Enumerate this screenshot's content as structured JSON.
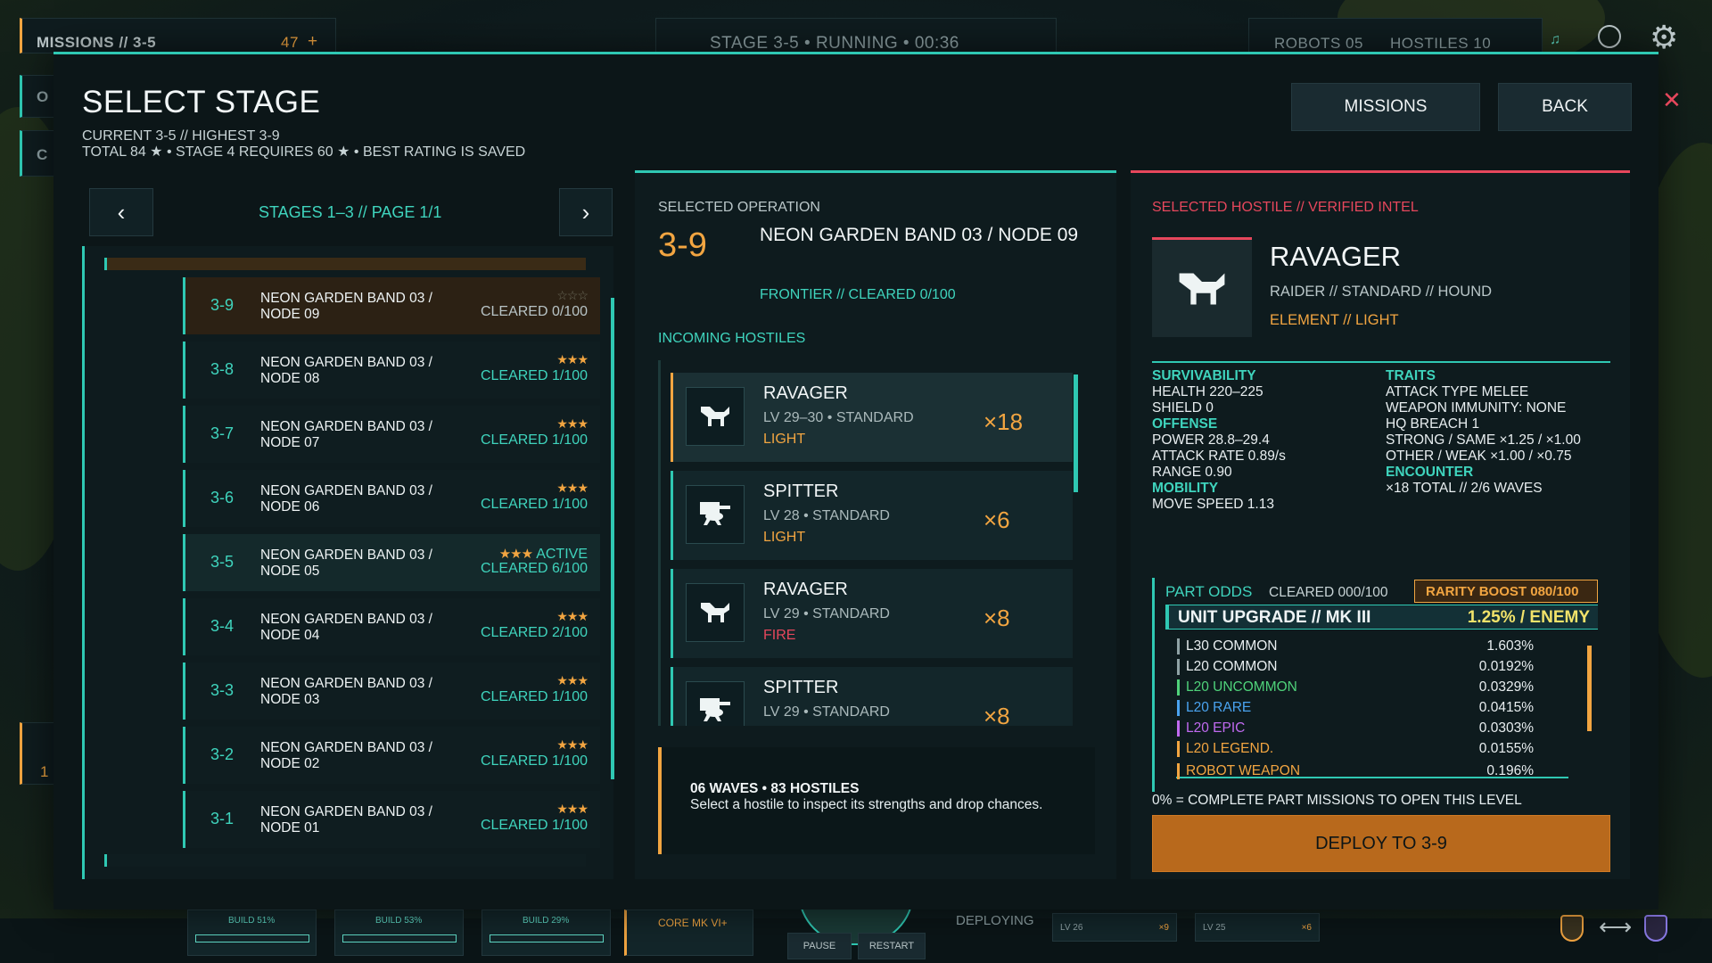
{
  "hud": {
    "missions": "MISSIONS // 3-5",
    "missions_count": "47",
    "plus": "+",
    "stage_status": "STAGE 3-5  •  RUNNING  •  00:36",
    "robots": "ROBOTS 05",
    "hostiles": "HOSTILES 10",
    "o": "O",
    "c": "C",
    "build_labels": [
      "BUILD 51%",
      "BUILD 53%",
      "BUILD 29%"
    ],
    "core": "CORE MK VI+",
    "deploying": "DEPLOYING",
    "pause": "PAUSE",
    "restart": "RESTART",
    "lv26": "LV 26",
    "x9": "×9",
    "lv25": "LV 25",
    "x6": "×6",
    "one": "1"
  },
  "header": {
    "title": "SELECT STAGE",
    "line1": "CURRENT 3-5  //  HIGHEST 3-9",
    "line2": "TOTAL 84 ★  •  STAGE 4 REQUIRES 60 ★  •  BEST RATING IS SAVED",
    "missions_btn": "MISSIONS",
    "back_btn": "BACK"
  },
  "stages": {
    "pager": "STAGES 1–3  //  PAGE 1/1",
    "prev": "‹",
    "next": "›",
    "rows": [
      {
        "num": "3-9",
        "name1": "NEON GARDEN BAND 03 /",
        "name2": "NODE 09",
        "stars": "☆☆☆",
        "cleared": "CLEARED 0/100",
        "state": "selected"
      },
      {
        "num": "3-8",
        "name1": "NEON GARDEN BAND 03 /",
        "name2": "NODE 08",
        "stars": "★★★",
        "cleared": "CLEARED 1/100",
        "state": ""
      },
      {
        "num": "3-7",
        "name1": "NEON GARDEN BAND 03 /",
        "name2": "NODE 07",
        "stars": "★★★",
        "cleared": "CLEARED 1/100",
        "state": ""
      },
      {
        "num": "3-6",
        "name1": "NEON GARDEN BAND 03 /",
        "name2": "NODE 06",
        "stars": "★★★",
        "cleared": "CLEARED 1/100",
        "state": ""
      },
      {
        "num": "3-5",
        "name1": "NEON GARDEN BAND 03 /",
        "name2": "NODE 05",
        "stars": "★★★",
        "active": "ACTIVE",
        "cleared": "CLEARED 6/100",
        "state": "active"
      },
      {
        "num": "3-4",
        "name1": "NEON GARDEN BAND 03 /",
        "name2": "NODE 04",
        "stars": "★★★",
        "cleared": "CLEARED 2/100",
        "state": ""
      },
      {
        "num": "3-3",
        "name1": "NEON GARDEN BAND 03 /",
        "name2": "NODE 03",
        "stars": "★★★",
        "cleared": "CLEARED 1/100",
        "state": ""
      },
      {
        "num": "3-2",
        "name1": "NEON GARDEN BAND 03 /",
        "name2": "NODE 02",
        "stars": "★★★",
        "cleared": "CLEARED 1/100",
        "state": ""
      },
      {
        "num": "3-1",
        "name1": "NEON GARDEN BAND 03 /",
        "name2": "NODE 01",
        "stars": "★★★",
        "cleared": "CLEARED 1/100",
        "state": ""
      }
    ]
  },
  "operation": {
    "label": "SELECTED OPERATION",
    "num": "3-9",
    "name": "NEON GARDEN BAND 03 / NODE 09",
    "meta": "FRONTIER  //  CLEARED 0/100",
    "incoming": "INCOMING HOSTILES",
    "hostiles": [
      {
        "name": "RAVAGER",
        "lv": "LV 29–30  •  STANDARD",
        "element": "LIGHT",
        "count": "×18",
        "icon": "hound-icon"
      },
      {
        "name": "SPITTER",
        "lv": "LV 28  •  STANDARD",
        "element": "LIGHT",
        "count": "×6",
        "icon": "turret-icon"
      },
      {
        "name": "RAVAGER",
        "lv": "LV 29  •  STANDARD",
        "element": "FIRE",
        "count": "×8",
        "icon": "hound-icon"
      },
      {
        "name": "SPITTER",
        "lv": "LV 29  •  STANDARD",
        "element": "",
        "count": "×8",
        "icon": "turret-icon"
      }
    ],
    "summary_title": "06 WAVES  •  83 HOSTILES",
    "summary_text": "Select a hostile to inspect its strengths and drop chances."
  },
  "intel": {
    "label": "SELECTED HOSTILE  //  VERIFIED INTEL",
    "name": "RAVAGER",
    "class": "RAIDER  //  STANDARD  //  HOUND",
    "element": "ELEMENT  //  LIGHT",
    "survivability": "SURVIVABILITY",
    "health": "HEALTH 220–225",
    "shield": "SHIELD 0",
    "offense": "OFFENSE",
    "power": "POWER 28.8–29.4",
    "attack_rate": "ATTACK RATE 0.89/s",
    "range": "RANGE 0.90",
    "mobility": "MOBILITY",
    "move_speed": "MOVE SPEED 1.13",
    "traits": "TRAITS",
    "attack_type": "ATTACK TYPE  MELEE",
    "weapon_immunity": "WEAPON IMMUNITY: NONE",
    "hq_breach": "HQ BREACH  1",
    "strong": "STRONG / SAME  ×1.25 / ×1.00",
    "other": "OTHER / WEAK  ×1.00 / ×0.75",
    "encounter": "ENCOUNTER",
    "encounter_val": "×18 TOTAL  //  2/6 WAVES",
    "part_odds": "PART ODDS",
    "part_cleared": "CLEARED 000/100",
    "rarity_boost": "RARITY BOOST 080/100",
    "upgrade": "UNIT UPGRADE  //  MK III",
    "upgrade_rate": "1.25% / ENEMY",
    "odds": [
      {
        "label": "L30 COMMON",
        "value": "1.603%",
        "color": "#e8eef0"
      },
      {
        "label": "L20 COMMON",
        "value": "0.0192%",
        "color": "#e8eef0"
      },
      {
        "label": "L20 UNCOMMON",
        "value": "0.0329%",
        "color": "#4fd27a"
      },
      {
        "label": "L20 RARE",
        "value": "0.0415%",
        "color": "#4aa3f0"
      },
      {
        "label": "L20 EPIC",
        "value": "0.0303%",
        "color": "#c06af0"
      },
      {
        "label": "L20 LEGEND.",
        "value": "0.0155%",
        "color": "#f2a541"
      },
      {
        "label": "ROBOT WEAPON",
        "value": "0.196%",
        "color": "#f2a541"
      }
    ],
    "note": "0% = COMPLETE PART MISSIONS TO OPEN THIS LEVEL",
    "deploy": "DEPLOY TO 3-9"
  },
  "colors": {
    "accent": "#2fc8b3",
    "orange": "#f2a541",
    "red": "#e6475c",
    "deploy_bg": "#b8691c"
  }
}
